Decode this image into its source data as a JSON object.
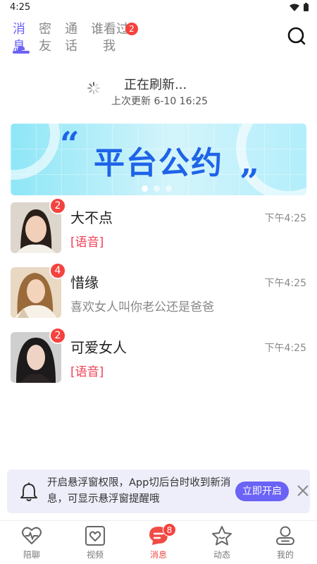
{
  "status": {
    "time": "4:25",
    "icons": [
      "wifi-icon",
      "battery-icon"
    ]
  },
  "top_tabs": {
    "items": [
      {
        "label": "消息",
        "active": true
      },
      {
        "label": "密友",
        "active": false
      },
      {
        "label": "通话",
        "active": false
      },
      {
        "label": "谁看过我",
        "active": false,
        "badge": "2"
      }
    ],
    "search_icon": "search-icon"
  },
  "refresh": {
    "title": "正在刷新...",
    "subtitle": "上次更新 6-10 16:25"
  },
  "banner": {
    "title": "平台公约",
    "quote_open": "“",
    "quote_close": "”",
    "pages": 3,
    "active_page": 0
  },
  "conversations": [
    {
      "name": "大不点",
      "message": "[语音]",
      "time": "下午4:25",
      "badge": "2",
      "voice": true
    },
    {
      "name": "惜缘",
      "message": "喜欢女人叫你老公还是爸爸",
      "time": "下午4:25",
      "badge": "4",
      "voice": false
    },
    {
      "name": "可爱女人",
      "message": "[语音]",
      "time": "下午4:25",
      "badge": "2",
      "voice": true
    }
  ],
  "notice": {
    "text": "开启悬浮窗权限，App切后台时收到新消息，可显示悬浮窗提醒哦",
    "button": "立即开启"
  },
  "bottom_nav": [
    {
      "label": "陪聊",
      "icon": "heartbeat-icon",
      "active": false
    },
    {
      "label": "视频",
      "icon": "video-heart-icon",
      "active": false
    },
    {
      "label": "消息",
      "icon": "message-icon",
      "active": true,
      "badge": "8"
    },
    {
      "label": "动态",
      "icon": "star-icon",
      "active": false
    },
    {
      "label": "我的",
      "icon": "profile-icon",
      "active": false
    }
  ],
  "colors": {
    "accent": "#6b62f6",
    "badge": "#f4433f",
    "voice": "#f03e55",
    "banner_text": "#1e63e8"
  }
}
